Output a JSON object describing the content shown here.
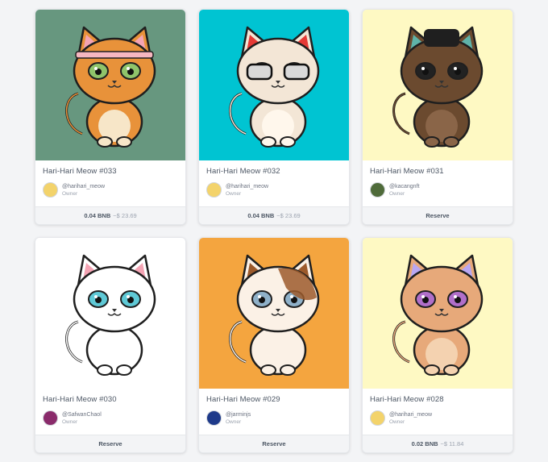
{
  "cards": [
    {
      "title": "Hari-Hari Meow #033",
      "owner": "@harihari_meow",
      "role": "Owner",
      "price": "0.04 BNB",
      "usd": "~$ 23.69",
      "bg": "#67977f",
      "avatar_color": "#f3d36b"
    },
    {
      "title": "Hari-Hari Meow #032",
      "owner": "@harihari_meow",
      "role": "Owner",
      "price": "0.04 BNB",
      "usd": "~$ 23.69",
      "bg": "#00c4d2",
      "avatar_color": "#f3d36b"
    },
    {
      "title": "Hari-Hari Meow #031",
      "owner": "@kacangnft",
      "role": "Owner",
      "reserve": "Reserve",
      "bg": "#fef9c3",
      "avatar_color": "#4f6b3a"
    },
    {
      "title": "Hari-Hari Meow #030",
      "owner": "@SafwanChaol",
      "role": "Owner",
      "reserve": "Reserve",
      "bg": "#ffffff",
      "avatar_color": "#8a2b6b"
    },
    {
      "title": "Hari-Hari Meow #029",
      "owner": "@jarminjs",
      "role": "Owner",
      "reserve": "Reserve",
      "bg": "#f4a53f",
      "avatar_color": "#1e3a8a"
    },
    {
      "title": "Hari-Hari Meow #028",
      "owner": "@harihari_meow",
      "role": "Owner",
      "price": "0.02 BNB",
      "usd": "~$ 11.84",
      "bg": "#fef9c3",
      "avatar_color": "#f3d36b"
    }
  ],
  "cats": [
    {
      "fur": "#e8923a",
      "belly": "#f7e6c8",
      "eye": "#8fc46a",
      "accent": "#f4a4b4",
      "icon": "cat-with-headband-and-fan"
    },
    {
      "fur": "#f3e6d6",
      "belly": "#fff7ec",
      "eye": "#222222",
      "accent": "#e53935",
      "icon": "cat-with-sunglasses"
    },
    {
      "fur": "#6b4a2f",
      "belly": "#8a6548",
      "eye": "#222222",
      "accent": "#5fb3a9",
      "icon": "cat-with-hat"
    },
    {
      "fur": "#ffffff",
      "belly": "#ffffff",
      "eye": "#5fc9d6",
      "accent": "#f4a4b4",
      "icon": "white-cat"
    },
    {
      "fur": "#fbf1e6",
      "belly": "#fbf1e6",
      "eye": "#8fb1c9",
      "accent": "#9c5a2b",
      "icon": "calico-cat"
    },
    {
      "fur": "#e7a97a",
      "belly": "#f4d2b0",
      "eye": "#b16fc9",
      "accent": "#b9a7f2",
      "icon": "tan-cat"
    }
  ]
}
